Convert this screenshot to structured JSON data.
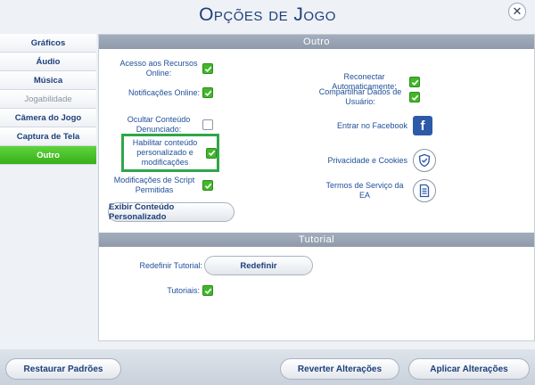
{
  "window": {
    "title": "Opções de Jogo",
    "close_glyph": "✕"
  },
  "sidebar": {
    "items": [
      {
        "label": "Gráficos",
        "state": "normal"
      },
      {
        "label": "Áudio",
        "state": "normal"
      },
      {
        "label": "Música",
        "state": "normal"
      },
      {
        "label": "Jogabilidade",
        "state": "disabled"
      },
      {
        "label": "Câmera do Jogo",
        "state": "normal"
      },
      {
        "label": "Captura de Tela",
        "state": "normal"
      },
      {
        "label": "Outro",
        "state": "active"
      }
    ]
  },
  "outro": {
    "header": "Outro",
    "online_access": {
      "label": "Acesso aos Recursos Online:",
      "checked": true
    },
    "online_notifications": {
      "label": "Notificações Online:",
      "checked": true
    },
    "hide_reported": {
      "label": "Ocultar Conteúdo Denunciado:",
      "checked": false
    },
    "enable_custom_content": {
      "label": "Habilitar conteúdo personalizado e modificações",
      "checked": true
    },
    "script_mods": {
      "label": "Modificações de Script Permitidas",
      "checked": true
    },
    "show_custom_content_button": "Exibir Conteúdo Personalizado",
    "auto_reconnect": {
      "label": "Reconectar Automaticamente:",
      "checked": true
    },
    "share_user_data": {
      "label": "Compartilhar Dados de Usuário:",
      "checked": true
    },
    "facebook": {
      "label": "Entrar no Facebook",
      "icon": "facebook-icon"
    },
    "privacy": {
      "label": "Privacidade e Cookies",
      "icon": "shield-check-icon"
    },
    "terms": {
      "label": "Termos de Serviço da EA",
      "icon": "document-icon"
    }
  },
  "tutorial": {
    "header": "Tutorial",
    "reset_label": "Redefinir Tutorial:",
    "reset_button": "Redefinir",
    "tutorials": {
      "label": "Tutoriais:",
      "checked": true
    }
  },
  "footer": {
    "restore_defaults": "Restaurar Padrões",
    "revert_changes": "Reverter Alterações",
    "apply_changes": "Aplicar Alterações"
  },
  "colors": {
    "accent_green": "#43b72a",
    "highlight_green": "#2ea64a",
    "text_blue": "#1f4f99",
    "header_gray": "#97a2b3"
  }
}
